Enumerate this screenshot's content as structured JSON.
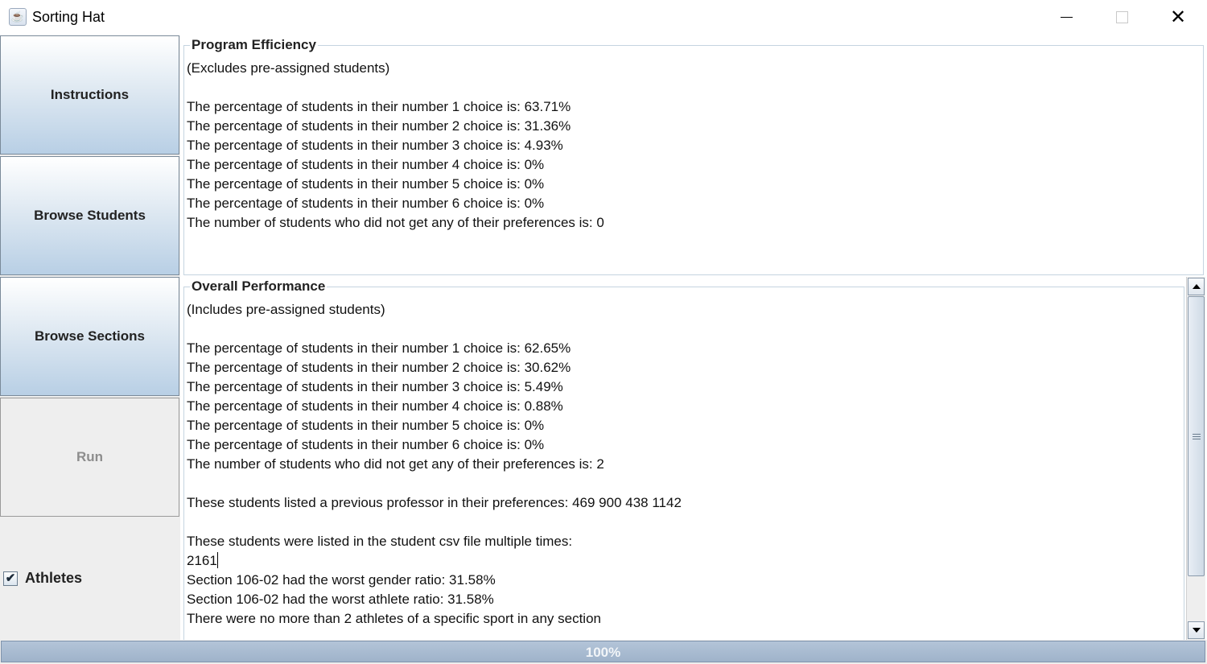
{
  "window": {
    "title": "Sorting Hat",
    "icon": "java-cup-icon",
    "close_glyph": "✕"
  },
  "sidebar": {
    "instructions_label": "Instructions",
    "browse_students_label": "Browse Students",
    "browse_sections_label": "Browse Sections",
    "run_label": "Run",
    "run_enabled": false,
    "athletes_label": "Athletes",
    "athletes_checked": true,
    "check_glyph": "✔"
  },
  "program_efficiency": {
    "title": "Program Efficiency",
    "text": "(Excludes pre-assigned students)\n\nThe percentage of students in their number 1 choice is: 63.71%\nThe percentage of students in their number 2 choice is: 31.36%\nThe percentage of students in their number 3 choice is: 4.93%\nThe percentage of students in their number 4 choice is: 0%\nThe percentage of students in their number 5 choice is: 0%\nThe percentage of students in their number 6 choice is: 0%\nThe number of students who did not get any of their preferences is: 0"
  },
  "overall_performance": {
    "title": "Overall Performance",
    "text_before_caret": "(Includes pre-assigned students)\n\nThe percentage of students in their number 1 choice is: 62.65%\nThe percentage of students in their number 2 choice is: 30.62%\nThe percentage of students in their number 3 choice is: 5.49%\nThe percentage of students in their number 4 choice is: 0.88%\nThe percentage of students in their number 5 choice is: 0%\nThe percentage of students in their number 6 choice is: 0%\nThe number of students who did not get any of their preferences is: 2\n\nThese students listed a previous professor in their preferences: 469 900 438 1142\n\nThese students were listed in the student csv file multiple times:\n2161",
    "text_after_caret": "\nSection 106-02 had the worst gender ratio: 31.58%\nSection 106-02 had the worst athlete ratio: 31.58%\nThere were no more than 2 athletes of a specific sport in any section"
  },
  "progress": {
    "value": 1.0,
    "label": "100%"
  },
  "colors": {
    "button_gradient_top": "#ffffff",
    "button_gradient_bottom": "#b8cfe5",
    "progress_fill": "#9fb3ca",
    "panel_border": "#c5d4e0"
  }
}
